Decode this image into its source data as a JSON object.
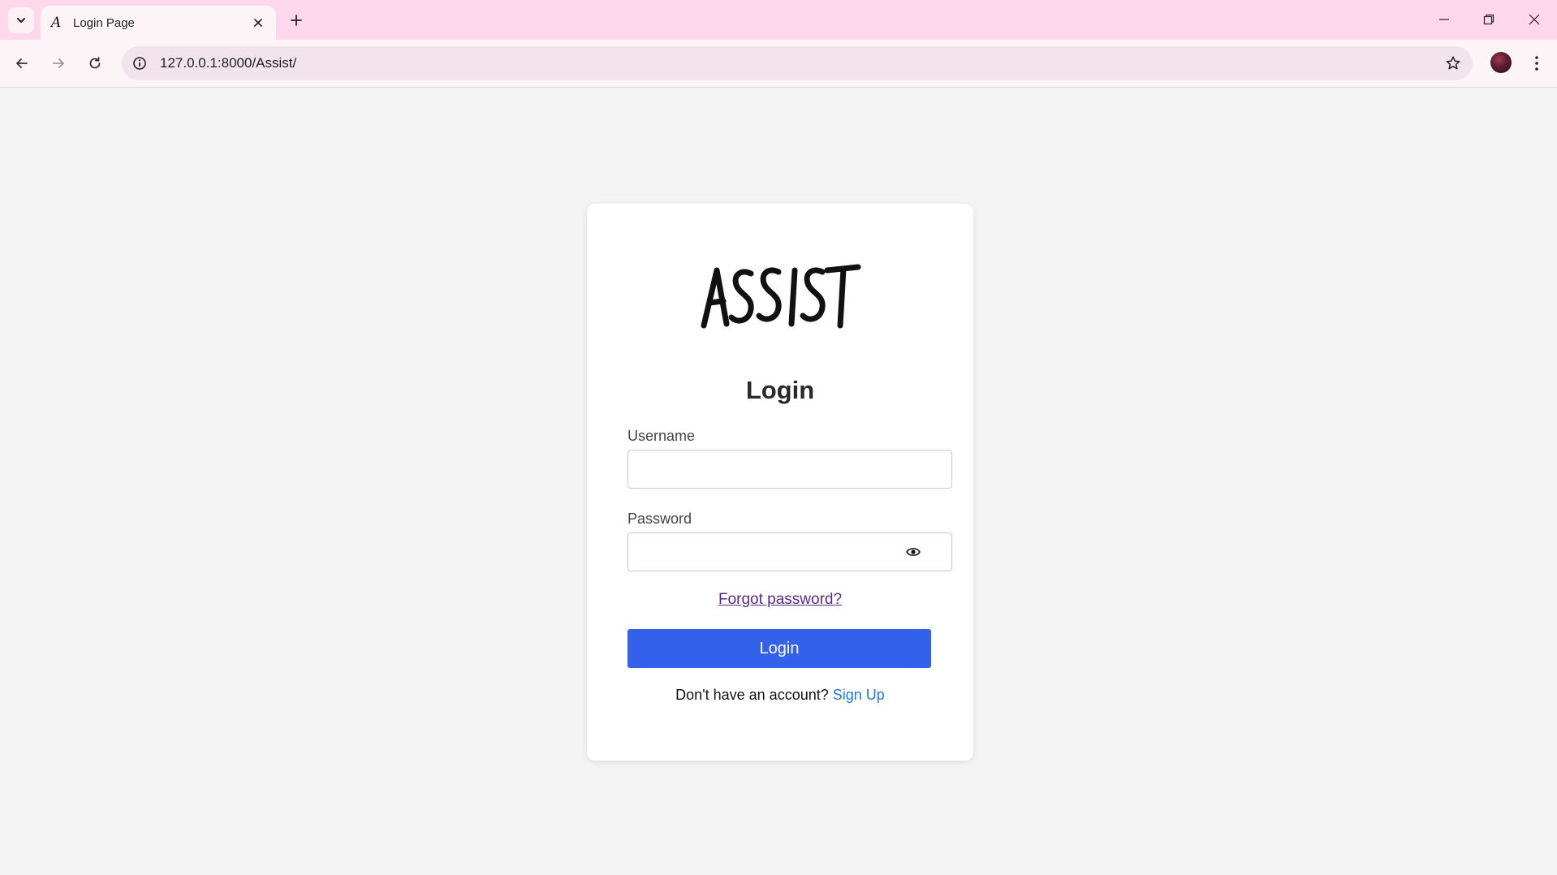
{
  "browser": {
    "tab_title": "Login Page",
    "tab_favicon_letter": "A",
    "url": "127.0.0.1:8000/Assist/",
    "icons": {
      "tab_search": "chevron-down-icon",
      "tab_close": "close-icon",
      "new_tab": "plus-icon",
      "minimize": "minimize-icon",
      "restore": "restore-icon",
      "close_window": "close-icon",
      "back": "arrow-left-icon",
      "forward": "arrow-right-icon",
      "reload": "reload-icon",
      "site_info": "info-icon",
      "bookmark": "star-icon",
      "menu": "kebab-menu-icon"
    },
    "colors": {
      "tabbar_bg": "#fcd8ea",
      "toolbar_bg": "#fdf4f8",
      "omnibox_bg": "#f3e3ec"
    }
  },
  "login": {
    "logo_text": "ASSIST",
    "title": "Login",
    "username_label": "Username",
    "username_value": "",
    "password_label": "Password",
    "password_value": "",
    "password_toggle_icon": "eye-icon",
    "forgot_password": "Forgot password?",
    "login_button": "Login",
    "signup_prompt": "Don't have an account?",
    "signup_link": "Sign Up",
    "colors": {
      "page_bg": "#f4f4f4",
      "card_bg": "#ffffff",
      "button_bg": "#3461eb",
      "signup_link": "#1f7ae0",
      "forgot_link": "#5a2a8a"
    }
  }
}
